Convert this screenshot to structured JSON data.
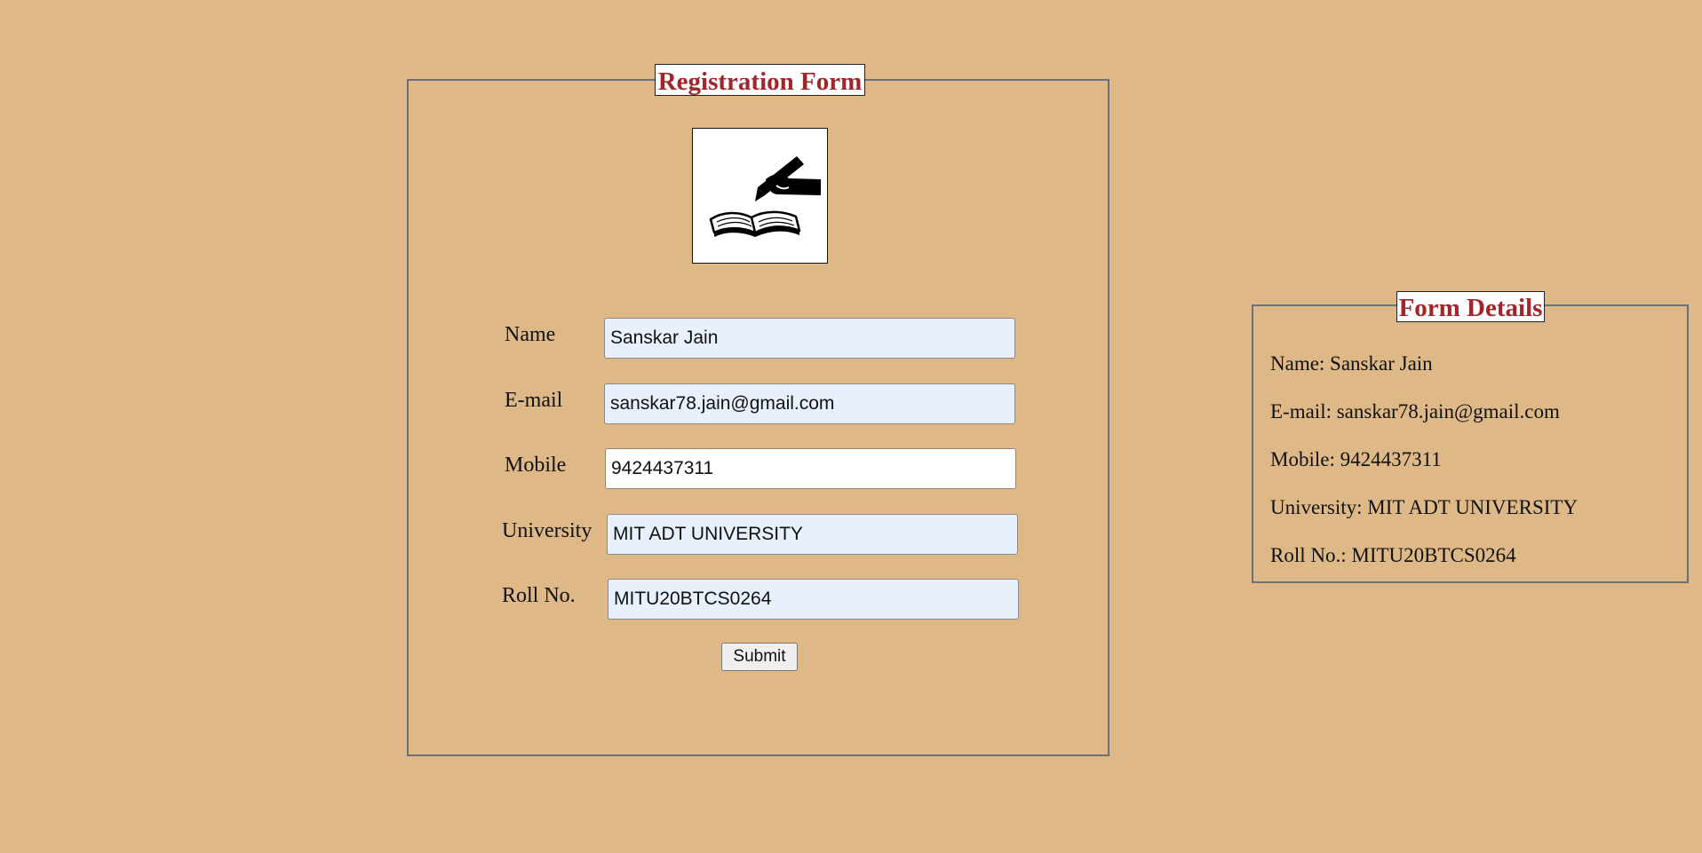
{
  "registration_form": {
    "title": "Registration Form",
    "logo_icon": "writing-hand-book-icon",
    "fields": [
      {
        "label": "Name",
        "value": "Sanskar Jain"
      },
      {
        "label": "E-mail",
        "value": "sanskar78.jain@gmail.com"
      },
      {
        "label": "Mobile",
        "value": "9424437311"
      },
      {
        "label": "University",
        "value": "MIT ADT UNIVERSITY"
      },
      {
        "label": "Roll No.",
        "value": "MITU20BTCS0264"
      }
    ],
    "submit_label": "Submit"
  },
  "form_details": {
    "title": "Form Details",
    "lines": [
      "Name: Sanskar Jain",
      "E-mail: sanskar78.jain@gmail.com",
      "Mobile: 9424437311",
      "University: MIT ADT UNIVERSITY",
      "Roll No.: MITU20BTCS0264"
    ]
  },
  "colors": {
    "background": "#DEB887",
    "legend_text": "#A0262C",
    "border": "#6B6F78",
    "autofill": "#E8F0FE"
  }
}
